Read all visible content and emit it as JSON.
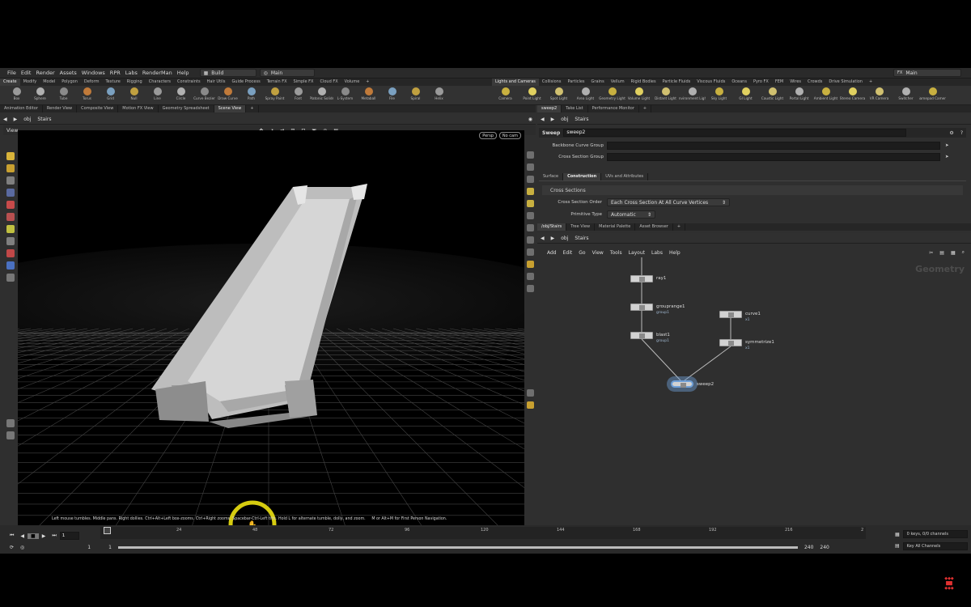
{
  "menubar": {
    "items": [
      "File",
      "Edit",
      "Render",
      "Assets",
      "Windows",
      "RPR",
      "Labs",
      "RenderMan",
      "Help"
    ],
    "desktop": "Build",
    "network": "Main",
    "right_desktop": "Main"
  },
  "shelf_left": {
    "tabs": [
      "Create",
      "Modify",
      "Model",
      "Polygon",
      "Deform",
      "Texture",
      "Rigging",
      "Characters",
      "Constraints",
      "Hair Utils",
      "Guide Process",
      "Terrain FX",
      "Simple FX",
      "Cloud FX",
      "Volume"
    ],
    "tools": [
      "Box",
      "Sphere",
      "Tube",
      "Torus",
      "Grid",
      "Null",
      "Line",
      "Circle",
      "Curve Bezier",
      "Draw Curve",
      "Path",
      "Spray Paint",
      "Font",
      "Platonic Solids",
      "L-System",
      "Metaball",
      "File",
      "Spiral",
      "Helix"
    ]
  },
  "shelf_right": {
    "tabs": [
      "Lights and Cameras",
      "Collisions",
      "Particles",
      "Grains",
      "Vellum",
      "Rigid Bodies",
      "Particle Fluids",
      "Viscous Fluids",
      "Oceans",
      "Pyro FX",
      "FEM",
      "Wires",
      "Crowds",
      "Drive Simulation"
    ],
    "tools": [
      "Camera",
      "Point Light",
      "Spot Light",
      "Area Light",
      "Geometry Light",
      "Volume Light",
      "Distant Light",
      "Environment Light",
      "Sky Light",
      "GI Light",
      "Caustic Light",
      "Portal Light",
      "Ambient Light",
      "Stereo Camera",
      "VR Camera",
      "Switcher",
      "Gamepad Camera"
    ]
  },
  "left_pane": {
    "tabs": [
      "Animation Editor",
      "Render View",
      "Composite View",
      "Motion FX View",
      "Geometry Spreadsheet",
      "Scene View"
    ],
    "path": [
      "obj",
      "Stairs"
    ],
    "view_label": "View",
    "persp": "Persp",
    "cam": "No cam",
    "hint": "Left mouse tumbles. Middle pans. Right dollies. Ctrl+Alt+Left box-zooms. Ctrl+Right zooms. Spacebar-Ctrl-Left tilts. Hold L for alternate tumble, dolly, and zoom.     M or Alt+M for First Person Navigation."
  },
  "params": {
    "tabs": [
      "sweep2",
      "Take List",
      "Performance Monitor"
    ],
    "path": [
      "obj",
      "Stairs"
    ],
    "node_type": "Sweep",
    "node_name": "sweep2",
    "backbone_label": "Backbone Curve Group",
    "cross_label": "Cross Section Group",
    "subtabs": [
      "Surface",
      "Construction",
      "UVs and Attributes"
    ],
    "section": "Cross Sections",
    "order_label": "Cross Section Order",
    "order_value": "Each Cross Section At All Curve Vertices",
    "prim_label": "Primitive Type",
    "prim_value": "Automatic"
  },
  "network": {
    "tabs": [
      "/obj/Stairs",
      "Tree View",
      "Material Palette",
      "Asset Browser"
    ],
    "path": [
      "obj",
      "Stairs"
    ],
    "menu": [
      "Add",
      "Edit",
      "Go",
      "View",
      "Tools",
      "Layout",
      "Labs",
      "Help"
    ],
    "watermark": "Geometry",
    "nodes": [
      {
        "name": "ray1",
        "sub": ""
      },
      {
        "name": "grouprange1",
        "sub": "group1"
      },
      {
        "name": "blast1",
        "sub": "group1"
      },
      {
        "name": "curve1",
        "sub": "x1"
      },
      {
        "name": "symmetrize1",
        "sub": "x1"
      },
      {
        "name": "sweep2",
        "sub": ""
      }
    ]
  },
  "timeline": {
    "frame": "1",
    "ticks": [
      "24",
      "48",
      "72",
      "96",
      "120",
      "144",
      "168",
      "192",
      "216",
      "2"
    ],
    "start": "1",
    "start2": "1",
    "end": "240",
    "end2": "240",
    "keys": "0 keys, 0/0 channels",
    "key_all": "Key All Channels"
  },
  "colors": {
    "accent": "#f0c040",
    "node_selected": "#6fa0d8",
    "viewport_bg": "#000000"
  }
}
